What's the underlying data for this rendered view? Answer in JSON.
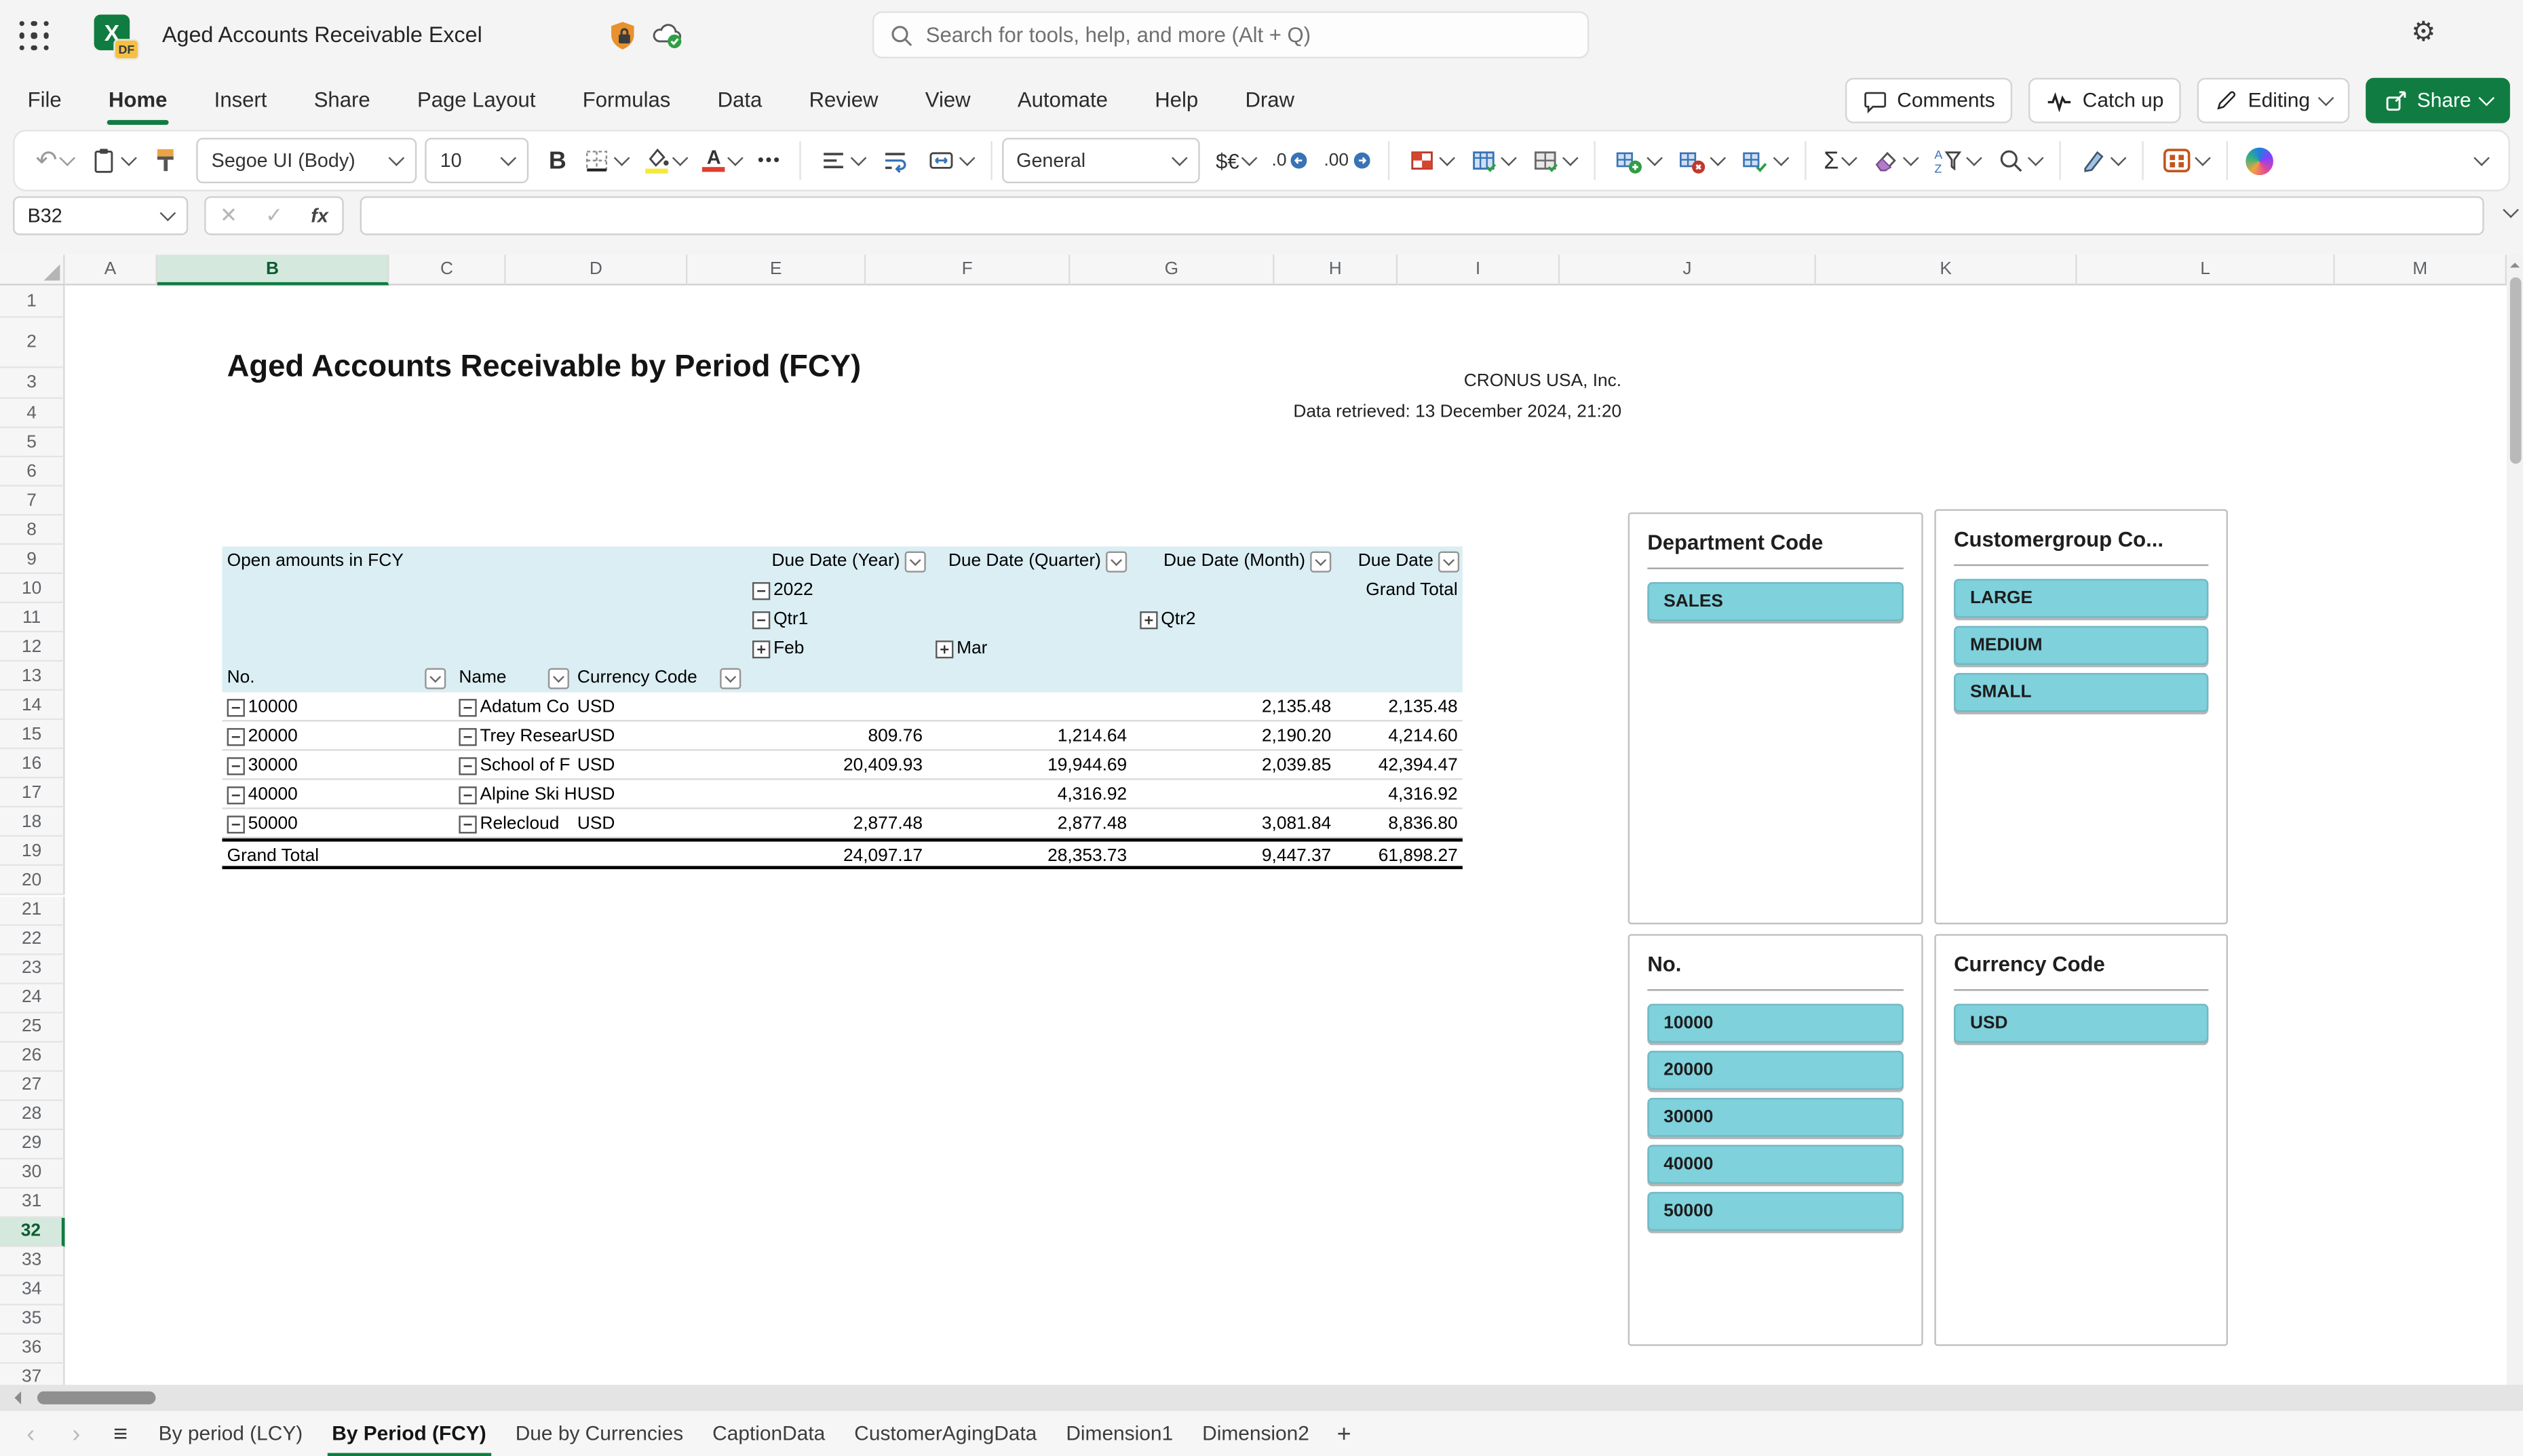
{
  "top_bar": {
    "title": "Aged Accounts Receivable Excel",
    "excel_letter": "X",
    "excel_badge": "DF",
    "search_placeholder": "Search for tools, help, and more (Alt + Q)"
  },
  "icons": {
    "app_launcher": "waffle-grid",
    "protection": "shield-lock",
    "save_status": "cloud-check",
    "settings": "gear",
    "search": "magnifier",
    "ribbon_more": "chevron-down"
  },
  "ribbon": {
    "tabs": [
      "File",
      "Home",
      "Insert",
      "Share",
      "Page Layout",
      "Formulas",
      "Data",
      "Review",
      "View",
      "Automate",
      "Help",
      "Draw"
    ],
    "active_tab": "Home",
    "actions": {
      "comments": "Comments",
      "catch_up": "Catch up",
      "editing": "Editing",
      "share": "Share"
    },
    "toolbar": {
      "font_name": "Segoe UI (Body)",
      "font_size": "10",
      "bold_label": "B",
      "number_format": "General",
      "currency_label": "$€",
      "decrease_decimal": ".0",
      "increase_decimal": ".00",
      "more_label": "•••",
      "autosum_label": "Σ"
    }
  },
  "formula_bar": {
    "name_box": "B32",
    "fx_label": "fx",
    "formula_value": ""
  },
  "grid": {
    "column_headers": [
      "A",
      "B",
      "C",
      "D",
      "E",
      "F",
      "G",
      "H",
      "I",
      "J",
      "K",
      "L",
      "M"
    ],
    "selected_column": "B",
    "row_count": 37,
    "selected_row": 32
  },
  "sheet": {
    "report_title": "Aged Accounts Receivable by Period (FCY)",
    "company": "CRONUS USA, Inc.",
    "retrieved": "Data retrieved: 13 December 2024, 21:20"
  },
  "pivot": {
    "caption": "Open amounts in FCY",
    "field_year": "Due Date (Year)",
    "field_quarter": "Due Date (Quarter)",
    "field_month": "Due Date (Month)",
    "field_date": "Due Date",
    "year": "2022",
    "grand_total_header": "Grand Total",
    "quarter_expanded": "Qtr1",
    "quarter_collapsed": "Qtr2",
    "month_feb": "Feb",
    "month_mar": "Mar",
    "row_field_no": "No.",
    "row_field_name": "Name",
    "row_field_currency": "Currency Code",
    "rows": [
      {
        "no": "10000",
        "name": "Adatum Co",
        "currency": "USD",
        "feb": "",
        "mar": "",
        "qtr2": "2,135.48",
        "total": "2,135.48"
      },
      {
        "no": "20000",
        "name": "Trey Resear",
        "currency": "USD",
        "feb": "809.76",
        "mar": "1,214.64",
        "qtr2": "2,190.20",
        "total": "4,214.60"
      },
      {
        "no": "30000",
        "name": "School of F",
        "currency": "USD",
        "feb": "20,409.93",
        "mar": "19,944.69",
        "qtr2": "2,039.85",
        "total": "42,394.47"
      },
      {
        "no": "40000",
        "name": "Alpine Ski H",
        "currency": "USD",
        "feb": "",
        "mar": "4,316.92",
        "qtr2": "",
        "total": "4,316.92"
      },
      {
        "no": "50000",
        "name": "Relecloud",
        "currency": "USD",
        "feb": "2,877.48",
        "mar": "2,877.48",
        "qtr2": "3,081.84",
        "total": "8,836.80"
      }
    ],
    "grand_total": {
      "label": "Grand Total",
      "feb": "24,097.17",
      "mar": "28,353.73",
      "qtr2": "9,447.37",
      "total": "61,898.27"
    }
  },
  "slicers": [
    {
      "title": "Department Code",
      "items": [
        "SALES"
      ]
    },
    {
      "title": "Customergroup Co...",
      "items": [
        "LARGE",
        "MEDIUM",
        "SMALL"
      ]
    },
    {
      "title": "No.",
      "items": [
        "10000",
        "20000",
        "30000",
        "40000",
        "50000"
      ]
    },
    {
      "title": "Currency Code",
      "items": [
        "USD"
      ]
    }
  ],
  "sheet_tabs": {
    "tabs": [
      "By period (LCY)",
      "By Period (FCY)",
      "Due by Currencies",
      "CaptionData",
      "CustomerAgingData",
      "Dimension1",
      "Dimension2"
    ],
    "active": "By Period (FCY)",
    "add_label": "+"
  },
  "colors": {
    "excel_green": "#107C41",
    "slicer_fill": "#7FD1DC",
    "pivot_header_fill": "#DAEEF3",
    "shield_orange": "#E8912D"
  }
}
